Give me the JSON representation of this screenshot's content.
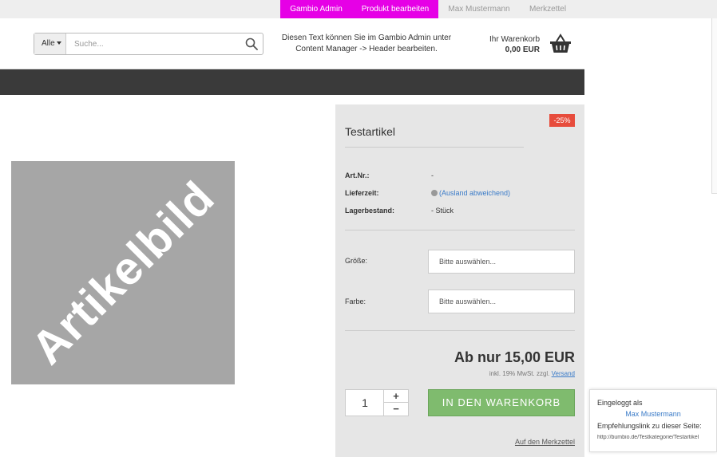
{
  "topbar": {
    "admin": "Gambio Admin",
    "edit_product": "Produkt bearbeiten",
    "user": "Max Mustermann",
    "wishlist": "Merkzettel"
  },
  "header": {
    "search": {
      "category": "Alle",
      "placeholder": "Suche..."
    },
    "info_line1": "Diesen Text können Sie im Gambio Admin unter",
    "info_line2": "Content Manager -> Header bearbeiten.",
    "cart": {
      "label": "Ihr Warenkorb",
      "amount": "0,00 EUR"
    }
  },
  "product": {
    "image_text": "Artikelbild",
    "badge": "-25%",
    "title": "Testartikel",
    "specs": [
      {
        "label": "Art.Nr.:",
        "value": "-"
      },
      {
        "label": "Lieferzeit:",
        "value": "(Ausland abweichend)"
      },
      {
        "label": "Lagerbestand:",
        "value": "- Stück"
      }
    ],
    "options": [
      {
        "label": "Größe:",
        "value": "Bitte auswählen..."
      },
      {
        "label": "Farbe:",
        "value": "Bitte auswählen..."
      }
    ],
    "price": "Ab nur 15,00 EUR",
    "tax_note": "inkl. 19% MwSt. zzgl.",
    "shipping_link": "Versand",
    "quantity": "1",
    "plus": "+",
    "minus": "−",
    "add_to_cart": "IN DEN WARENKORB",
    "wishlist_link": "Auf den Merkzettel"
  },
  "login_box": {
    "logged_in_as": "Eingeloggt als",
    "user_name": "Max Mustermann",
    "referral_label": "Empfehlungslink zu dieser Seite:",
    "referral_url": "http://bumbio.de/Testkategorie/Testartikel"
  },
  "colors": {
    "admin_accent": "#e600e6",
    "navbar": "#3a3a3a",
    "cart_button": "#7fbb6e",
    "badge": "#e74c3c",
    "link": "#3a7bc8"
  }
}
